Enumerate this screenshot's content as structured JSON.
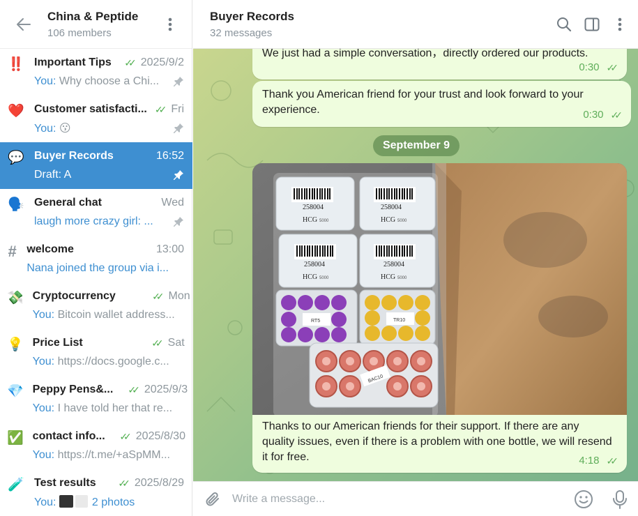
{
  "sidebar": {
    "title": "China & Peptide",
    "subtitle": "106 members",
    "chats": [
      {
        "icon": "double-exclamation-icon",
        "emoji": "‼️",
        "name": "Important Tips",
        "time": "2025/9/2",
        "read": true,
        "sender": "You:",
        "preview": "Why choose a Chi...",
        "pinned": true
      },
      {
        "icon": "red-heart-icon",
        "emoji": "❤️",
        "name": "Customer satisfacti...",
        "time": "Fri",
        "read": true,
        "sender": "You:",
        "preview": "😗",
        "pinned": true
      },
      {
        "icon": "speech-bubble-icon",
        "emoji": "💬",
        "name": "Buyer Records",
        "time": "16:52",
        "read": false,
        "sender": "",
        "preview": "Draft: A",
        "pinned": true,
        "active": true
      },
      {
        "icon": "speaking-head-icon",
        "emoji": "🗣️",
        "name": "General chat",
        "time": "Wed",
        "read": false,
        "sender": "",
        "preview": "laugh more crazy girl: ...",
        "preview_blue": true,
        "pinned": true
      },
      {
        "icon": "hashtag-icon",
        "emoji": "#",
        "name": "welcome",
        "time": "13:00",
        "read": false,
        "sender": "",
        "preview": "Nana joined the group via i...",
        "preview_blue": true,
        "pinned": false
      },
      {
        "icon": "money-wings-icon",
        "emoji": "💸",
        "name": "Cryptocurrency",
        "time": "Mon",
        "read": true,
        "sender": "You:",
        "preview": "Bitcoin wallet address...",
        "pinned": false
      },
      {
        "icon": "light-bulb-icon",
        "emoji": "💡",
        "name": "Price List",
        "time": "Sat",
        "read": true,
        "sender": "You:",
        "preview": "https://docs.google.c...",
        "pinned": false
      },
      {
        "icon": "gem-icon",
        "emoji": "💎",
        "name": "Peppy Pens&...",
        "time": "2025/9/3",
        "read": true,
        "sender": "You:",
        "preview": "I have told her that re...",
        "pinned": false
      },
      {
        "icon": "check-box-icon",
        "emoji": "✅",
        "name": "contact info...",
        "time": "2025/8/30",
        "read": true,
        "sender": "You:",
        "preview": "https://t.me/+aSpMM...",
        "pinned": false
      },
      {
        "icon": "test-tube-icon",
        "emoji": "🧪",
        "name": "Test results",
        "time": "2025/8/29",
        "read": true,
        "sender": "You:",
        "preview": "2 photos",
        "preview_blue": true,
        "thumbs": true,
        "pinned": false
      }
    ]
  },
  "header": {
    "title": "Buyer Records",
    "subtitle": "32 messages"
  },
  "messages": [
    {
      "text": "We just had a simple conversation，directly ordered our products.",
      "time": "0:30"
    },
    {
      "text": "Thank you American friend for your trust and look forward to your experience.",
      "time": "0:30"
    },
    {
      "date": "September 9"
    },
    {
      "text": "Thanks to our American friends for their support. If there are any quality issues, even if there is a problem with one bottle, we will resend it for free.",
      "time": "4:18"
    }
  ],
  "photo_labels": {
    "barcode": "258004",
    "brand": "HCG",
    "size": "5000",
    "purple": "RT5",
    "yellow": "TR10",
    "pink": "BAC10"
  },
  "composer": {
    "placeholder": "Write a message..."
  },
  "colors": {
    "accent": "#3e8fd1",
    "bubble": "#effdde",
    "read_check": "#4fae4e"
  }
}
